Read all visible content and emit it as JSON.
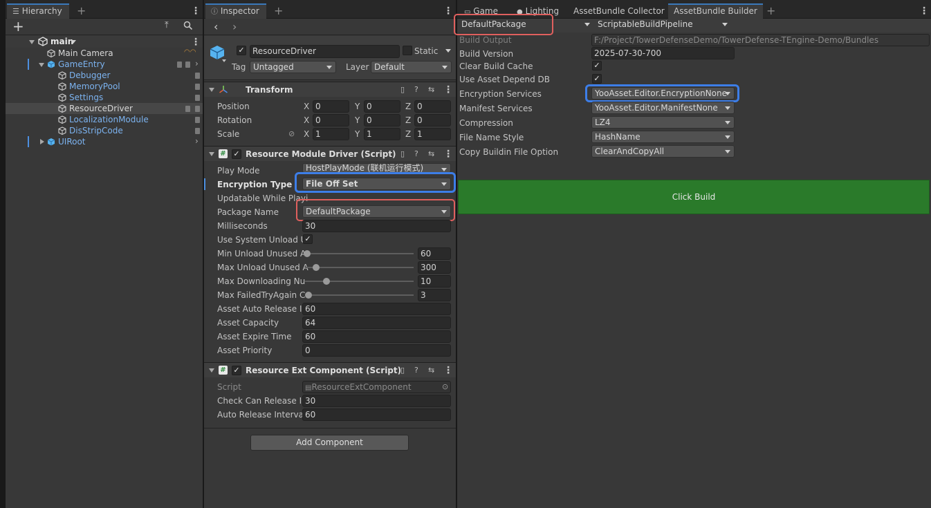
{
  "hierarchy": {
    "tab_label": "Hierarchy",
    "scene_name": "main",
    "items": [
      {
        "label": "Main Camera"
      },
      {
        "label": "GameEntry"
      },
      {
        "label": "Debugger"
      },
      {
        "label": "MemoryPool"
      },
      {
        "label": "Settings"
      },
      {
        "label": "ResourceDriver"
      },
      {
        "label": "LocalizationModule"
      },
      {
        "label": "DisStripCode"
      },
      {
        "label": "UIRoot"
      }
    ]
  },
  "inspector": {
    "tab_label": "Inspector",
    "object_name": "ResourceDriver",
    "static_label": "Static",
    "tag_label": "Tag",
    "tag_value": "Untagged",
    "layer_label": "Layer",
    "layer_value": "Default",
    "transform": {
      "title": "Transform",
      "position_label": "Position",
      "rotation_label": "Rotation",
      "scale_label": "Scale",
      "axis_x": "X",
      "axis_y": "Y",
      "axis_z": "Z",
      "position": [
        "0",
        "0",
        "0"
      ],
      "rotation": [
        "0",
        "0",
        "0"
      ],
      "scale": [
        "1",
        "1",
        "1"
      ]
    },
    "resource_module": {
      "title": "Resource Module Driver (Script)",
      "play_mode_label": "Play Mode",
      "play_mode_value": "HostPlayMode (联机运行模式)",
      "encryption_type_label": "Encryption Type",
      "encryption_type_value": "File Off Set",
      "updatable_label": "Updatable While Playi",
      "package_name_label": "Package Name",
      "package_name_value": "DefaultPackage",
      "milliseconds_label": "Milliseconds",
      "milliseconds_value": "30",
      "use_system_unload_label": "Use System Unload U",
      "min_unload_label": "Min Unload Unused A",
      "min_unload_value": "60",
      "min_unload_level": 0.02,
      "max_unload_label": "Max Unload Unused A",
      "max_unload_value": "300",
      "max_unload_level": 0.1,
      "max_downloading_label": "Max Downloading Nu",
      "max_downloading_value": "10",
      "max_downloading_level": 0.2,
      "max_failed_label": "Max FailedTryAgain C",
      "max_failed_value": "3",
      "max_failed_level": 0.03,
      "asset_auto_release_label": "Asset Auto Release In",
      "asset_auto_release_value": "60",
      "asset_capacity_label": "Asset Capacity",
      "asset_capacity_value": "64",
      "asset_expire_label": "Asset Expire Time",
      "asset_expire_value": "60",
      "asset_priority_label": "Asset Priority",
      "asset_priority_value": "0"
    },
    "resource_ext": {
      "title": "Resource Ext Component (Script)",
      "script_label": "Script",
      "script_value": "ResourceExtComponent",
      "check_can_release_label": "Check Can Release In",
      "check_can_release_value": "30",
      "auto_release_label": "Auto Release Interval",
      "auto_release_value": "60"
    },
    "add_component_label": "Add Component"
  },
  "right": {
    "tabs": [
      {
        "label": "Game"
      },
      {
        "label": "Lighting"
      },
      {
        "label": "AssetBundle Collector"
      },
      {
        "label": "AssetBundle Builder"
      }
    ],
    "package_value": "DefaultPackage",
    "pipeline_value": "ScriptableBuildPipeline",
    "build_output_label": "Build Output",
    "build_output_value": "F:/Project/TowerDefenseDemo/TowerDefense-TEngine-Demo/Bundles",
    "build_version_label": "Build Version",
    "build_version_value": "2025-07-30-700",
    "clear_cache_label": "Clear Build Cache",
    "use_depend_db_label": "Use Asset Depend DB",
    "encryption_services_label": "Encryption Services",
    "encryption_services_value": "YooAsset.Editor.EncryptionNone",
    "manifest_services_label": "Manifest Services",
    "manifest_services_value": "YooAsset.Editor.ManifestNone",
    "compression_label": "Compression",
    "compression_value": "LZ4",
    "file_name_style_label": "File Name Style",
    "file_name_style_value": "HashName",
    "copy_buildin_label": "Copy Buildin File Option",
    "copy_buildin_value": "ClearAndCopyAll",
    "click_build_label": "Click Build"
  },
  "colors": {
    "highlight_red": "#e0605e",
    "highlight_blue": "#3d7ee8",
    "build_button": "#2a7a2a",
    "link_blue": "#7cb3f0"
  }
}
